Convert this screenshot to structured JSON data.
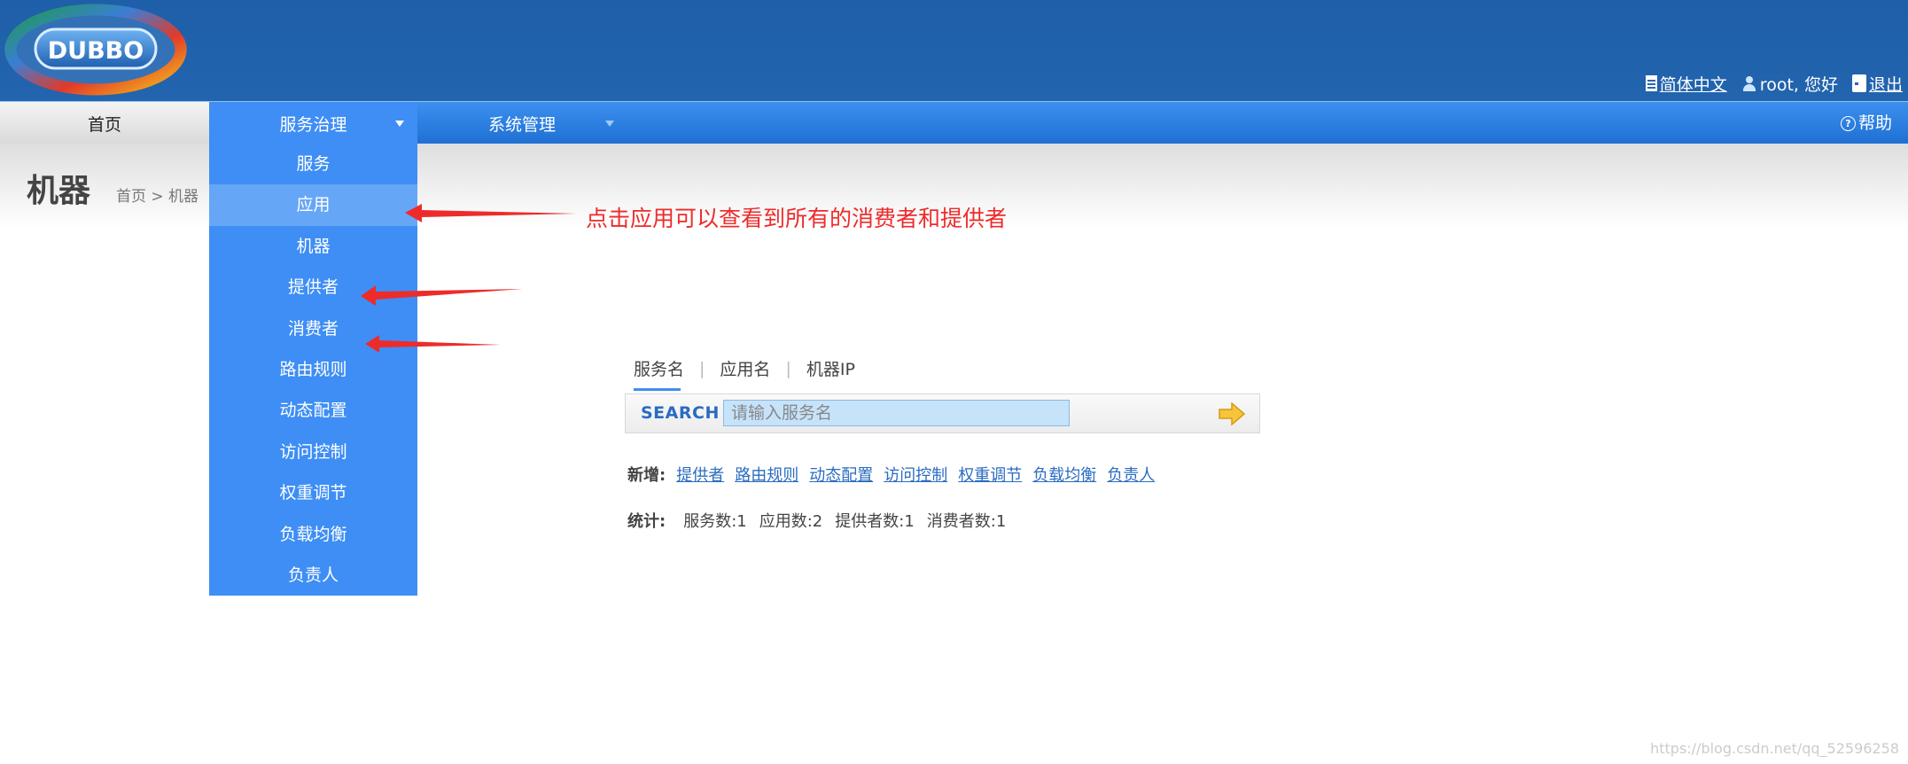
{
  "header": {
    "logo_text": "DUBBO",
    "language_label": "简体中文",
    "user_greeting": "root, 您好",
    "logout_label": "退出"
  },
  "nav": {
    "home": "首页",
    "service_governance": "服务治理",
    "system_management": "系统管理",
    "help": "帮助"
  },
  "page": {
    "title": "机器",
    "breadcrumb": "首页 > 机器"
  },
  "dropdown": {
    "items": [
      {
        "label": "服务"
      },
      {
        "label": "应用"
      },
      {
        "label": "机器"
      },
      {
        "label": "提供者"
      },
      {
        "label": "消费者"
      },
      {
        "label": "路由规则"
      },
      {
        "label": "动态配置"
      },
      {
        "label": "访问控制"
      },
      {
        "label": "权重调节"
      },
      {
        "label": "负载均衡"
      },
      {
        "label": "负责人"
      }
    ],
    "highlighted": "应用"
  },
  "annotation": {
    "text": "点击应用可以查看到所有的消费者和提供者",
    "color": "#ee2b2b"
  },
  "search": {
    "tabs": [
      "服务名",
      "应用名",
      "机器IP"
    ],
    "active_tab": "服务名",
    "label": "SEARCH",
    "placeholder": "请输入服务名",
    "value": ""
  },
  "add": {
    "label": "新增:",
    "links": [
      "提供者",
      "路由规则",
      "动态配置",
      "访问控制",
      "权重调节",
      "负载均衡",
      "负责人"
    ]
  },
  "stats": {
    "label": "统计:",
    "services": "服务数:1",
    "applications": "应用数:2",
    "providers": "提供者数:1",
    "consumers": "消费者数:1"
  },
  "watermark": "https://blog.csdn.net/qq_52596258",
  "colors": {
    "header_blue": "#2264ae",
    "nav_blue": "#3e8ef5",
    "link_blue": "#2a6cc0",
    "annotation_red": "#ee2b2b"
  }
}
